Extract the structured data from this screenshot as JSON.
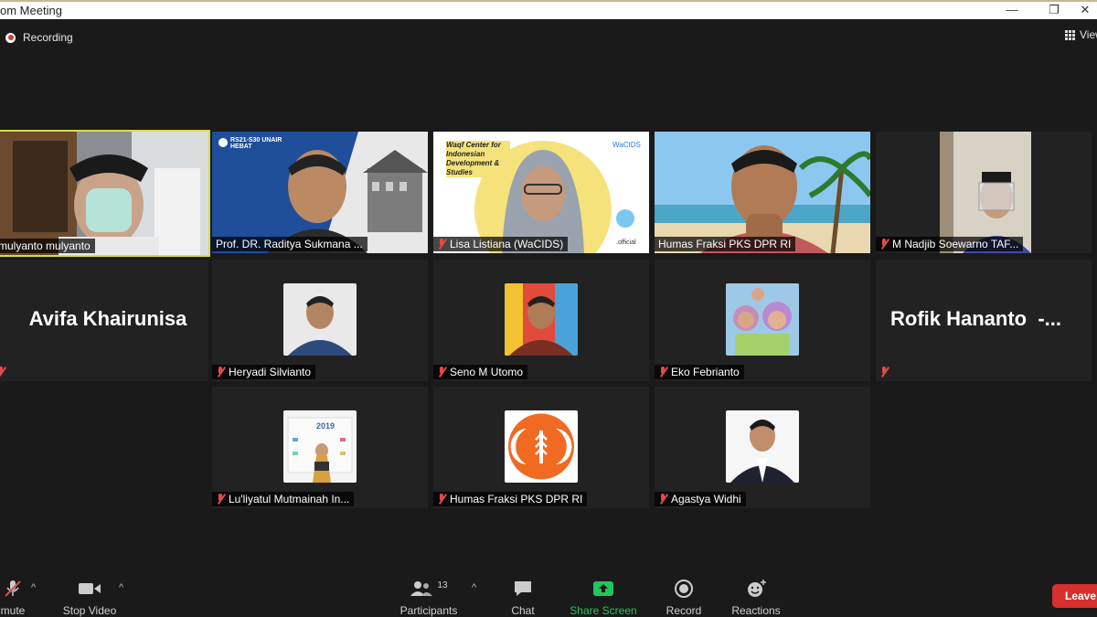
{
  "window": {
    "title": "om Meeting"
  },
  "recording": {
    "label": "Recording"
  },
  "view": {
    "label": "View"
  },
  "tiles": [
    {
      "name": "mulyanto mulyanto",
      "type": "video",
      "muted": false,
      "active": true
    },
    {
      "name": "Prof. DR. Raditya Sukmana ...",
      "type": "video",
      "muted": false,
      "slide_text": "RS21-S30 UNAIR HEBAT"
    },
    {
      "name": "Lisa Listiana (WaCIDS)",
      "type": "video",
      "muted": true,
      "slide_text": "Waqf Center for Indonesian Development & Studies",
      "brand": "WaCIDS",
      "brand_suffix": ".official"
    },
    {
      "name": "Humas Fraksi PKS DPR RI",
      "type": "video",
      "muted": false
    },
    {
      "name": "M Nadjib Soewarno TAF...",
      "type": "video",
      "muted": true
    },
    {
      "name": "Avifa Khairunisa",
      "type": "name-only",
      "muted": true
    },
    {
      "name": "Heryadi Silvianto",
      "type": "avatar",
      "muted": true
    },
    {
      "name": "Seno M Utomo",
      "type": "avatar",
      "muted": true
    },
    {
      "name": "Eko Febrianto",
      "type": "avatar",
      "muted": true
    },
    {
      "name": "Rofik Hananto",
      "type": "name-only",
      "muted": true,
      "display": "Rofik Hananto  -..."
    },
    {
      "name": "Lu'liyatul Mutmainah In...",
      "type": "avatar",
      "muted": true,
      "poster_text": "2019"
    },
    {
      "name": "Humas Fraksi PKS DPR RI",
      "type": "avatar-logo",
      "muted": true
    },
    {
      "name": "Agastya Widhi",
      "type": "avatar",
      "muted": true
    }
  ],
  "toolbar": {
    "unmute": "mute",
    "stop_video": "Stop Video",
    "participants": "Participants",
    "participant_count": "13",
    "chat": "Chat",
    "share_screen": "Share Screen",
    "record": "Record",
    "reactions": "Reactions",
    "leave": "Leave"
  },
  "colors": {
    "background": "#1a1a1a",
    "active_border": "#d7dc4a",
    "muted_red": "#e04b4b",
    "share_green": "#22c55e",
    "leave_red": "#d7302f",
    "pks_orange": "#f06a22"
  }
}
